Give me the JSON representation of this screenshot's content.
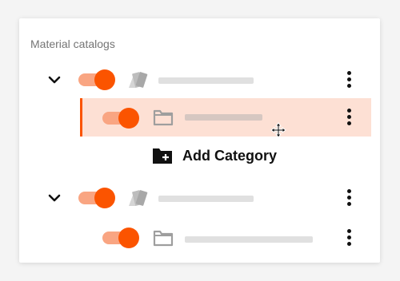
{
  "panel": {
    "title": "Material catalogs"
  },
  "catalogs": [
    {
      "expanded": true,
      "enabled": true,
      "icon": "material-swatch-icon",
      "action_icon": "more-vertical-icon",
      "expand_icon": "chevron-down-icon"
    },
    {
      "expanded": true,
      "enabled": true,
      "icon": "material-swatch-icon",
      "action_icon": "more-vertical-icon",
      "expand_icon": "chevron-down-icon"
    }
  ],
  "categories": [
    {
      "parent": 0,
      "enabled": true,
      "selected": true,
      "icon": "folder-icon",
      "action_icon": "more-vertical-icon"
    },
    {
      "parent": 1,
      "enabled": true,
      "selected": false,
      "icon": "folder-icon",
      "action_icon": "more-vertical-icon"
    }
  ],
  "add_category": {
    "label": "Add Category",
    "icon": "folder-add-icon"
  },
  "cursor": "move-cursor-icon",
  "colors": {
    "accent": "#fb5400",
    "toggle_track": "#f9a582",
    "selected_row": "#fde0d4",
    "placeholder_bar": "#e0e0e0",
    "icon_grey": "#9e9e9e"
  }
}
